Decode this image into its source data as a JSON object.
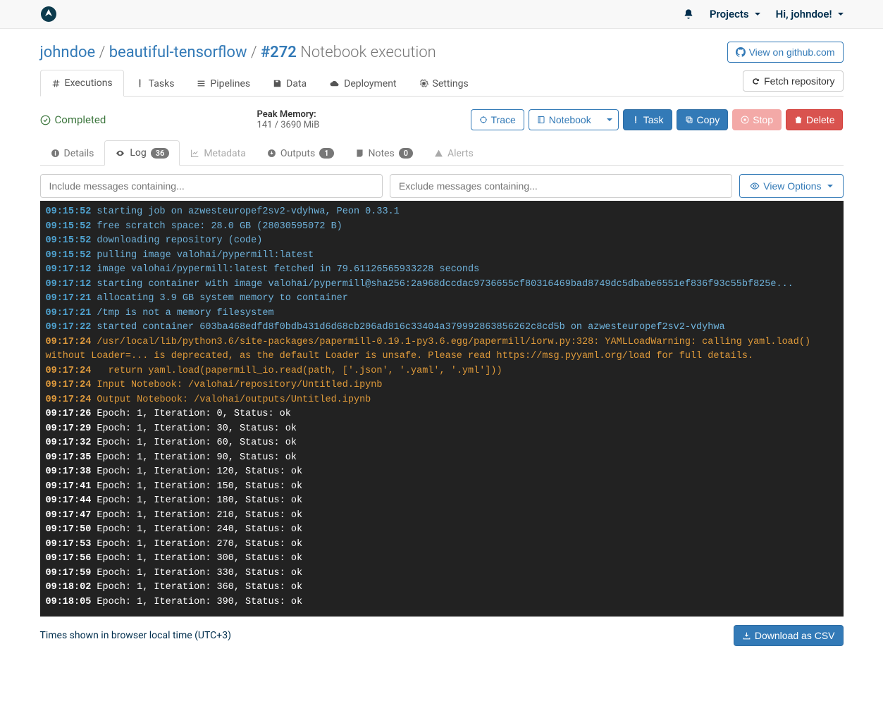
{
  "topbar": {
    "projects_label": "Projects",
    "greeting": "Hi, johndoe!"
  },
  "breadcrumb": {
    "user": "johndoe",
    "project": "beautiful-tensorflow",
    "exec_hash": "#272",
    "exec_title": "Notebook execution"
  },
  "github_btn": "View on github.com",
  "main_tabs": {
    "executions": "Executions",
    "tasks": "Tasks",
    "pipelines": "Pipelines",
    "data": "Data",
    "deployment": "Deployment",
    "settings": "Settings"
  },
  "fetch_btn": "Fetch repository",
  "status": {
    "text": "Completed",
    "peak_label": "Peak Memory:",
    "peak_value": "141 / 3690 MiB"
  },
  "actions": {
    "trace": "Trace",
    "notebook": "Notebook",
    "task": "Task",
    "copy": "Copy",
    "stop": "Stop",
    "delete": "Delete"
  },
  "sub_tabs": {
    "details": "Details",
    "log": "Log",
    "log_badge": "36",
    "metadata": "Metadata",
    "outputs": "Outputs",
    "outputs_badge": "1",
    "notes": "Notes",
    "notes_badge": "0",
    "alerts": "Alerts"
  },
  "filters": {
    "include_placeholder": "Include messages containing...",
    "exclude_placeholder": "Exclude messages containing...",
    "view_options": "View Options"
  },
  "log_lines": [
    {
      "ts": "09:15:52",
      "level": "info",
      "msg": "starting job on azwesteuropef2sv2-vdyhwa, Peon 0.33.1"
    },
    {
      "ts": "09:15:52",
      "level": "info",
      "msg": "free scratch space: 28.0 GB (28030595072 B)"
    },
    {
      "ts": "09:15:52",
      "level": "info",
      "msg": "downloading repository (code)"
    },
    {
      "ts": "09:15:52",
      "level": "info",
      "msg": "pulling image valohai/pypermill:latest"
    },
    {
      "ts": "09:17:12",
      "level": "info",
      "msg": "image valohai/pypermill:latest fetched in 79.61126565933228 seconds"
    },
    {
      "ts": "09:17:12",
      "level": "info",
      "msg": "starting container with image valohai/pypermill@sha256:2a968dccdac9736655cf80316469bad8749dc5dbabe6551ef836f93c55bf825e..."
    },
    {
      "ts": "09:17:21",
      "level": "info",
      "msg": "allocating 3.9 GB system memory to container"
    },
    {
      "ts": "09:17:21",
      "level": "info",
      "msg": "/tmp is not a memory filesystem"
    },
    {
      "ts": "09:17:22",
      "level": "info",
      "msg": "started container 603ba468edfd8f0bdb431d6d68cb206ad816c33404a379992863856262c8cd5b on azwesteuropef2sv2-vdyhwa"
    },
    {
      "ts": "09:17:24",
      "level": "warn",
      "msg": "/usr/local/lib/python3.6/site-packages/papermill-0.19.1-py3.6.egg/papermill/iorw.py:328: YAMLLoadWarning: calling yaml.load() without Loader=... is deprecated, as the default Loader is unsafe. Please read https://msg.pyyaml.org/load for full details."
    },
    {
      "ts": "09:17:24",
      "level": "warn",
      "msg": "  return yaml.load(papermill_io.read(path, ['.json', '.yaml', '.yml']))"
    },
    {
      "ts": "09:17:24",
      "level": "warn",
      "msg": "Input Notebook: /valohai/repository/Untitled.ipynb"
    },
    {
      "ts": "09:17:24",
      "level": "warn",
      "msg": "Output Notebook: /valohai/outputs/Untitled.ipynb"
    },
    {
      "ts": "09:17:26",
      "level": "plain",
      "msg": "Epoch: 1, Iteration: 0, Status: ok"
    },
    {
      "ts": "09:17:29",
      "level": "plain",
      "msg": "Epoch: 1, Iteration: 30, Status: ok"
    },
    {
      "ts": "09:17:32",
      "level": "plain",
      "msg": "Epoch: 1, Iteration: 60, Status: ok"
    },
    {
      "ts": "09:17:35",
      "level": "plain",
      "msg": "Epoch: 1, Iteration: 90, Status: ok"
    },
    {
      "ts": "09:17:38",
      "level": "plain",
      "msg": "Epoch: 1, Iteration: 120, Status: ok"
    },
    {
      "ts": "09:17:41",
      "level": "plain",
      "msg": "Epoch: 1, Iteration: 150, Status: ok"
    },
    {
      "ts": "09:17:44",
      "level": "plain",
      "msg": "Epoch: 1, Iteration: 180, Status: ok"
    },
    {
      "ts": "09:17:47",
      "level": "plain",
      "msg": "Epoch: 1, Iteration: 210, Status: ok"
    },
    {
      "ts": "09:17:50",
      "level": "plain",
      "msg": "Epoch: 1, Iteration: 240, Status: ok"
    },
    {
      "ts": "09:17:53",
      "level": "plain",
      "msg": "Epoch: 1, Iteration: 270, Status: ok"
    },
    {
      "ts": "09:17:56",
      "level": "plain",
      "msg": "Epoch: 1, Iteration: 300, Status: ok"
    },
    {
      "ts": "09:17:59",
      "level": "plain",
      "msg": "Epoch: 1, Iteration: 330, Status: ok"
    },
    {
      "ts": "09:18:02",
      "level": "plain",
      "msg": "Epoch: 1, Iteration: 360, Status: ok"
    },
    {
      "ts": "09:18:05",
      "level": "plain",
      "msg": "Epoch: 1, Iteration: 390, Status: ok"
    }
  ],
  "footer": {
    "tz_note": "Times shown in browser local time (UTC+3)",
    "download_btn": "Download as CSV"
  }
}
